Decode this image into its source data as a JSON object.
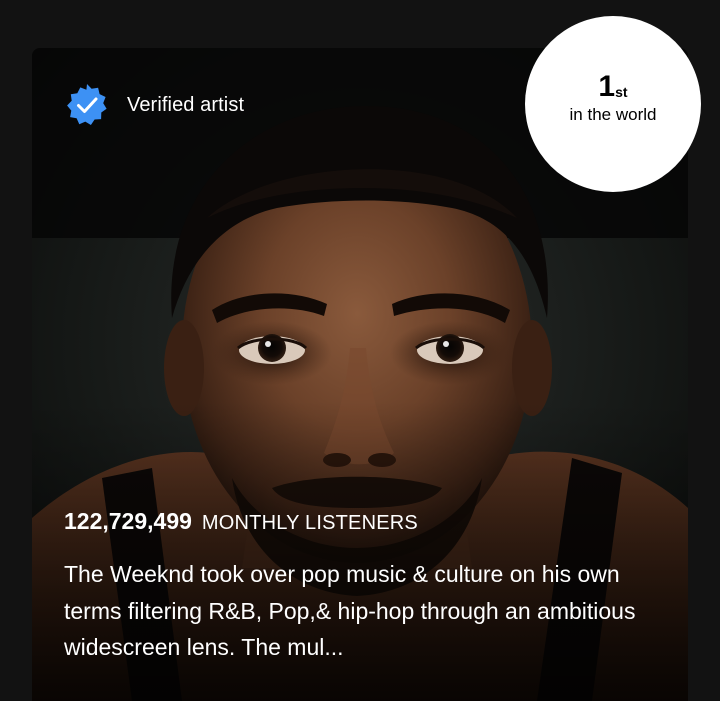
{
  "about": {
    "verified_label": "Verified artist",
    "monthly_listeners": "122,729,499",
    "monthly_listeners_label": "MONTHLY LISTENERS",
    "bio": "The Weeknd took over pop music & culture on his own terms filtering R&B, Pop,& hip-hop through an ambitious widescreen lens. The mul..."
  },
  "rank": {
    "number": "1",
    "suffix": "st",
    "caption": "in the world"
  },
  "colors": {
    "background": "#121212",
    "verified_badge": "#3d91f4",
    "rank_badge": "#ffffff"
  }
}
